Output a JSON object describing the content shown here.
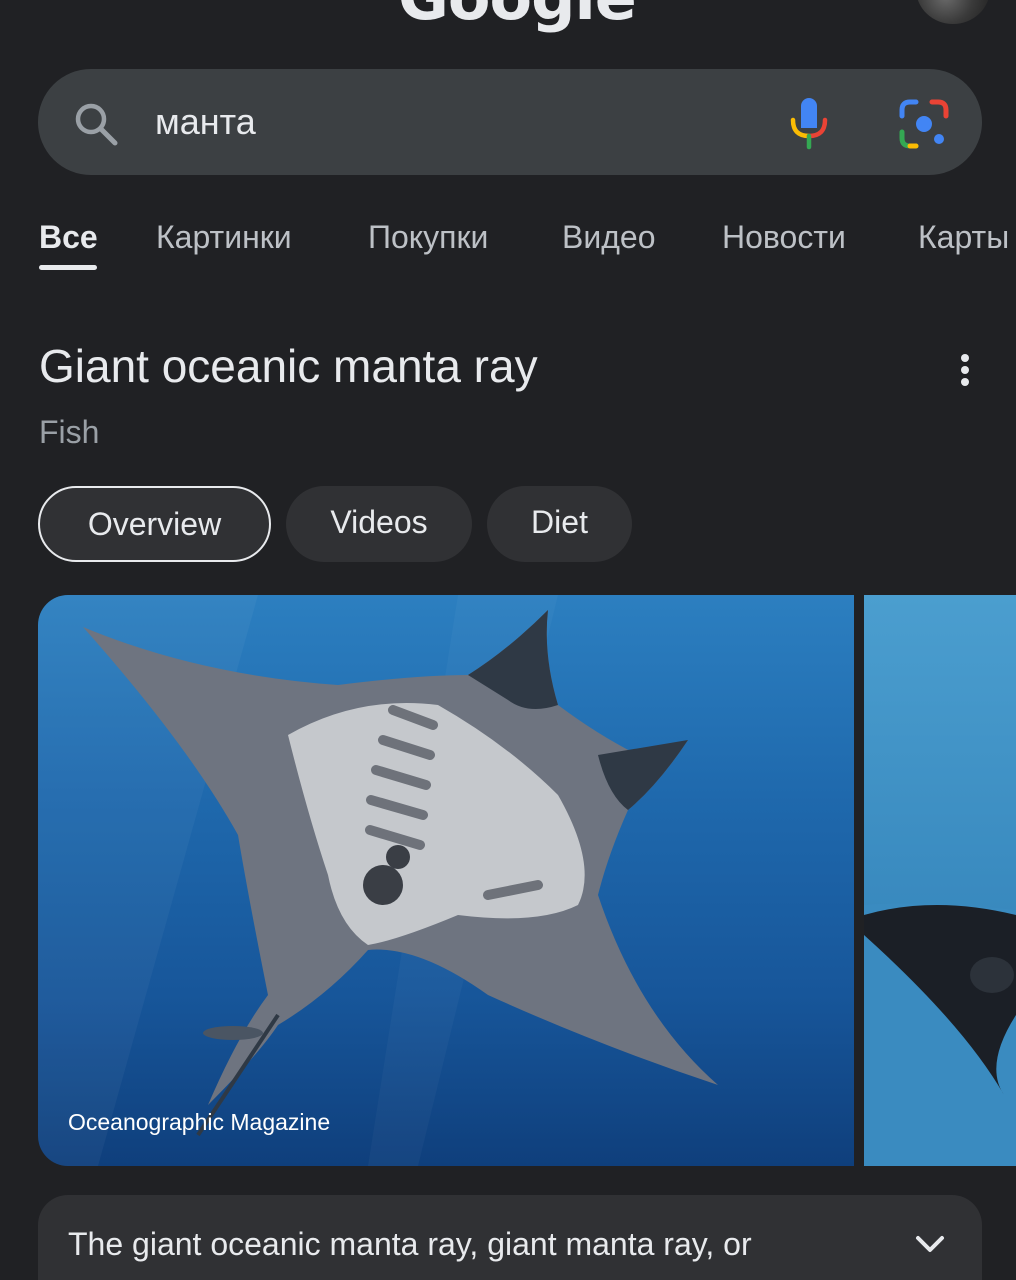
{
  "header": {
    "logo_text": "Google",
    "menu_icon": "hamburger-menu-icon",
    "avatar": "account-avatar"
  },
  "search": {
    "query": "манта",
    "icons": [
      "search-icon",
      "microphone-icon",
      "google-lens-icon"
    ]
  },
  "tabs": [
    {
      "label": "Все",
      "active": true
    },
    {
      "label": "Картинки",
      "active": false
    },
    {
      "label": "Покупки",
      "active": false
    },
    {
      "label": "Видео",
      "active": false
    },
    {
      "label": "Новости",
      "active": false
    },
    {
      "label": "Карты",
      "active": false
    }
  ],
  "knowledge_panel": {
    "title": "Giant oceanic manta ray",
    "subtitle": "Fish",
    "chips": [
      {
        "label": "Overview",
        "selected": true
      },
      {
        "label": "Videos",
        "selected": false
      },
      {
        "label": "Diet",
        "selected": false
      }
    ],
    "image_credit": "Oceanographic Magazine",
    "description": "The giant oceanic manta ray, giant manta ray, or"
  },
  "colors": {
    "background": "#202124",
    "surface": "#303134",
    "search_bar": "#3c4043",
    "text_primary": "#e8eaed",
    "text_secondary": "#9aa0a6"
  }
}
